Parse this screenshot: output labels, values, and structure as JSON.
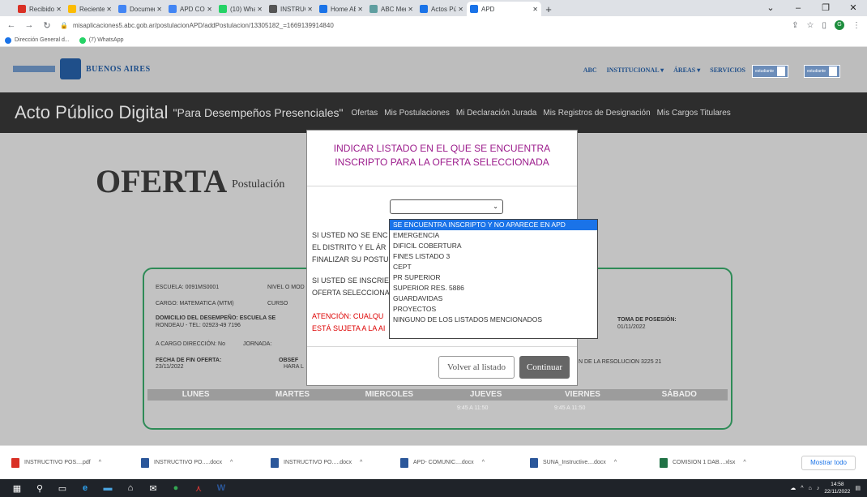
{
  "browser": {
    "tabs": [
      {
        "label": "Recibidos (3",
        "color": "#d93025"
      },
      {
        "label": "Recientes",
        "color": "#fbbc04"
      },
      {
        "label": "Documento",
        "color": "#4285f4"
      },
      {
        "label": "APD COMU",
        "color": "#4285f4"
      },
      {
        "label": "(10) WhatsA",
        "color": "#25d366"
      },
      {
        "label": "INSTRUCTIV",
        "color": "#555555"
      },
      {
        "label": "Home ABC",
        "color": "#1a73e8"
      },
      {
        "label": "ABC Menú",
        "color": "#5f9ea0"
      },
      {
        "label": "Actos Públic",
        "color": "#1a73e8"
      },
      {
        "label": "APD",
        "color": "#1a73e8",
        "active": true
      }
    ],
    "url": "misaplicaciones5.abc.gob.ar/postulacionAPD/addPostulacion/13305182_=1669139914840",
    "bookmarks": [
      "Dirección General d...",
      "(7) WhatsApp"
    ]
  },
  "site_header": {
    "brand": "BUENOS AIRES",
    "nav": [
      "ABC",
      "INSTITUCIONAL ▾",
      "ÁREAS ▾",
      "SERVICIOS"
    ],
    "btn1": "estudiante",
    "btn2": "estudiante"
  },
  "appbar": {
    "title": "Acto Público Digital",
    "subtitle": "\"Para Desempeños Presenciales\"",
    "nav": [
      "Ofertas",
      "Mis Postulaciones",
      "Mi Declaración Jurada",
      "Mis Registros de Designación",
      "Mis Cargos Titulares"
    ]
  },
  "page": {
    "heading": "OFERTA",
    "subheading": "Postulación"
  },
  "card": {
    "escuela": "ESCUELA: 0091MS0001",
    "nivel": "NIVEL O MOD",
    "cargo": "CARGO: MATEMATICA (MTM)",
    "curso": "CURSO",
    "domicilio": "DOMICILIO DEL DESEMPEÑO: ESCUELA SE",
    "telefono": "RONDEAU - TEL: 02923-49 7196",
    "cargo_dir": "A CARGO DIRECCIÓN: No",
    "jornada": "JORNADA:",
    "fecha_fin_label": "FECHA DE FIN OFERTA:",
    "fecha_fin": "23/11/2022",
    "obs_label": "OBSEF",
    "obs_sub": "HARA L",
    "toma_label": "TOMA DE POSESIÓN:",
    "toma": "01/11/2022",
    "resolucion": "N DE LA RESOLUCION 3225 21",
    "days": [
      "LUNES",
      "MARTES",
      "MIERCOLES",
      "JUEVES",
      "VIERNES",
      "SÁBADO"
    ],
    "jueves_hours": "9:45 A 11:50",
    "viernes_hours": "9:45 A 11:50"
  },
  "modal": {
    "title_line1": "INDICAR LISTADO EN EL QUE SE ENCUENTRA",
    "title_line2": "INSCRIPTO PARA LA OFERTA SELECCIONADA",
    "text1_l1": "SI USTED NO SE ENC",
    "text1_l2": "EL DISTRITO Y EL ÁR",
    "text1_l3": "FINALIZAR SU POSTU",
    "text2_l1": "SI USTED SE INSCRIE",
    "text2_l2": "OFERTA SELECCIONA",
    "warn_l1": "ATENCIÓN: CUALQU",
    "warn_l2": "ESTÁ SUJETA A LA AI",
    "back_label": "Volver al listado",
    "continue_label": "Continuar",
    "options": [
      "SE ENCUENTRA INSCRIPTO Y NO APARECE EN APD",
      "EMERGENCIA",
      "DIFICIL COBERTURA",
      "FINES LISTADO 3",
      "CEPT",
      "PR SUPERIOR",
      "SUPERIOR RES. 5886",
      "GUARDAVIDAS",
      "PROYECTOS",
      "NINGUNO DE LOS LISTADOS MENCIONADOS"
    ]
  },
  "downloads": [
    {
      "name": "INSTRUCTIVO POS....pdf",
      "color": "#d93025"
    },
    {
      "name": "INSTRUCTIVO PO.....docx",
      "color": "#2b579a"
    },
    {
      "name": "INSTRUCTIVO PO.....docx",
      "color": "#2b579a"
    },
    {
      "name": "APD- COMUNIC....docx",
      "color": "#2b579a"
    },
    {
      "name": "SUNA_Instructive....docx",
      "color": "#2b579a"
    },
    {
      "name": "COMISION 1 DAB....xlsx",
      "color": "#217346"
    }
  ],
  "downloads_showall": "Mostrar todo",
  "taskbar": {
    "time": "14:58",
    "date": "22/11/2022"
  }
}
